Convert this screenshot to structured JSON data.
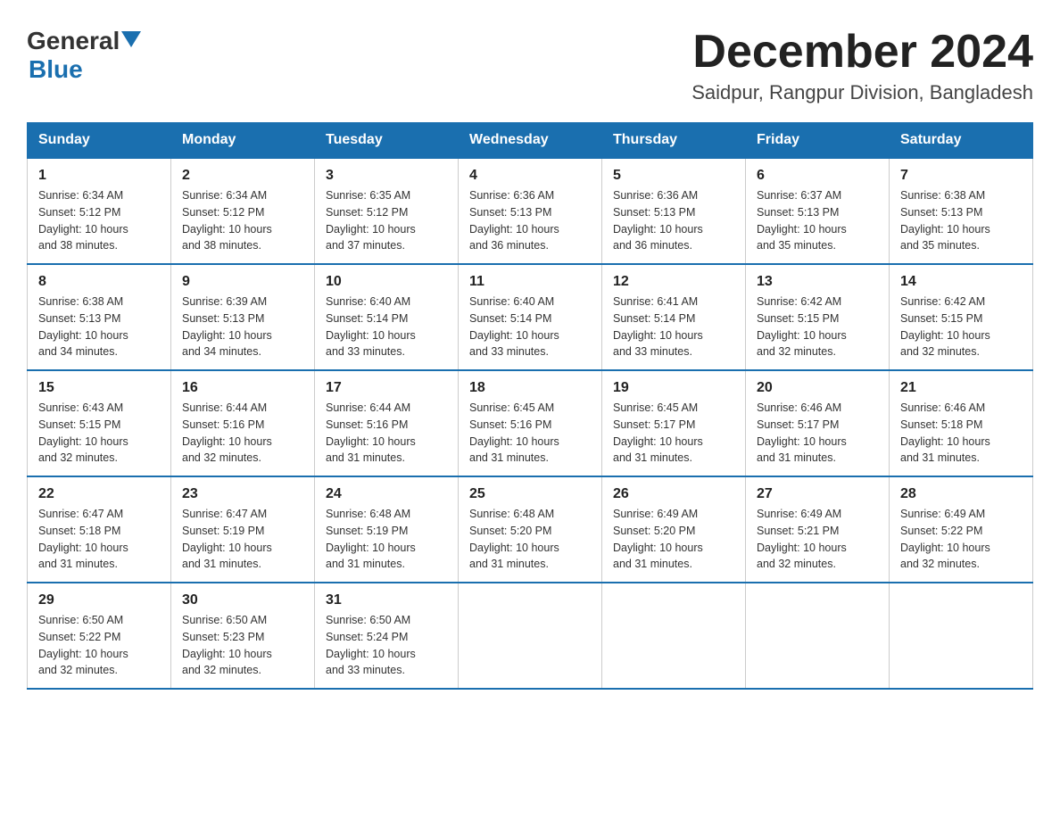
{
  "header": {
    "logo": {
      "general": "General",
      "blue": "Blue"
    },
    "title": "December 2024",
    "subtitle": "Saidpur, Rangpur Division, Bangladesh"
  },
  "calendar": {
    "days_of_week": [
      "Sunday",
      "Monday",
      "Tuesday",
      "Wednesday",
      "Thursday",
      "Friday",
      "Saturday"
    ],
    "weeks": [
      [
        {
          "day": "1",
          "sunrise": "6:34 AM",
          "sunset": "5:12 PM",
          "daylight": "10 hours and 38 minutes."
        },
        {
          "day": "2",
          "sunrise": "6:34 AM",
          "sunset": "5:12 PM",
          "daylight": "10 hours and 38 minutes."
        },
        {
          "day": "3",
          "sunrise": "6:35 AM",
          "sunset": "5:12 PM",
          "daylight": "10 hours and 37 minutes."
        },
        {
          "day": "4",
          "sunrise": "6:36 AM",
          "sunset": "5:13 PM",
          "daylight": "10 hours and 36 minutes."
        },
        {
          "day": "5",
          "sunrise": "6:36 AM",
          "sunset": "5:13 PM",
          "daylight": "10 hours and 36 minutes."
        },
        {
          "day": "6",
          "sunrise": "6:37 AM",
          "sunset": "5:13 PM",
          "daylight": "10 hours and 35 minutes."
        },
        {
          "day": "7",
          "sunrise": "6:38 AM",
          "sunset": "5:13 PM",
          "daylight": "10 hours and 35 minutes."
        }
      ],
      [
        {
          "day": "8",
          "sunrise": "6:38 AM",
          "sunset": "5:13 PM",
          "daylight": "10 hours and 34 minutes."
        },
        {
          "day": "9",
          "sunrise": "6:39 AM",
          "sunset": "5:13 PM",
          "daylight": "10 hours and 34 minutes."
        },
        {
          "day": "10",
          "sunrise": "6:40 AM",
          "sunset": "5:14 PM",
          "daylight": "10 hours and 33 minutes."
        },
        {
          "day": "11",
          "sunrise": "6:40 AM",
          "sunset": "5:14 PM",
          "daylight": "10 hours and 33 minutes."
        },
        {
          "day": "12",
          "sunrise": "6:41 AM",
          "sunset": "5:14 PM",
          "daylight": "10 hours and 33 minutes."
        },
        {
          "day": "13",
          "sunrise": "6:42 AM",
          "sunset": "5:15 PM",
          "daylight": "10 hours and 32 minutes."
        },
        {
          "day": "14",
          "sunrise": "6:42 AM",
          "sunset": "5:15 PM",
          "daylight": "10 hours and 32 minutes."
        }
      ],
      [
        {
          "day": "15",
          "sunrise": "6:43 AM",
          "sunset": "5:15 PM",
          "daylight": "10 hours and 32 minutes."
        },
        {
          "day": "16",
          "sunrise": "6:44 AM",
          "sunset": "5:16 PM",
          "daylight": "10 hours and 32 minutes."
        },
        {
          "day": "17",
          "sunrise": "6:44 AM",
          "sunset": "5:16 PM",
          "daylight": "10 hours and 31 minutes."
        },
        {
          "day": "18",
          "sunrise": "6:45 AM",
          "sunset": "5:16 PM",
          "daylight": "10 hours and 31 minutes."
        },
        {
          "day": "19",
          "sunrise": "6:45 AM",
          "sunset": "5:17 PM",
          "daylight": "10 hours and 31 minutes."
        },
        {
          "day": "20",
          "sunrise": "6:46 AM",
          "sunset": "5:17 PM",
          "daylight": "10 hours and 31 minutes."
        },
        {
          "day": "21",
          "sunrise": "6:46 AM",
          "sunset": "5:18 PM",
          "daylight": "10 hours and 31 minutes."
        }
      ],
      [
        {
          "day": "22",
          "sunrise": "6:47 AM",
          "sunset": "5:18 PM",
          "daylight": "10 hours and 31 minutes."
        },
        {
          "day": "23",
          "sunrise": "6:47 AM",
          "sunset": "5:19 PM",
          "daylight": "10 hours and 31 minutes."
        },
        {
          "day": "24",
          "sunrise": "6:48 AM",
          "sunset": "5:19 PM",
          "daylight": "10 hours and 31 minutes."
        },
        {
          "day": "25",
          "sunrise": "6:48 AM",
          "sunset": "5:20 PM",
          "daylight": "10 hours and 31 minutes."
        },
        {
          "day": "26",
          "sunrise": "6:49 AM",
          "sunset": "5:20 PM",
          "daylight": "10 hours and 31 minutes."
        },
        {
          "day": "27",
          "sunrise": "6:49 AM",
          "sunset": "5:21 PM",
          "daylight": "10 hours and 32 minutes."
        },
        {
          "day": "28",
          "sunrise": "6:49 AM",
          "sunset": "5:22 PM",
          "daylight": "10 hours and 32 minutes."
        }
      ],
      [
        {
          "day": "29",
          "sunrise": "6:50 AM",
          "sunset": "5:22 PM",
          "daylight": "10 hours and 32 minutes."
        },
        {
          "day": "30",
          "sunrise": "6:50 AM",
          "sunset": "5:23 PM",
          "daylight": "10 hours and 32 minutes."
        },
        {
          "day": "31",
          "sunrise": "6:50 AM",
          "sunset": "5:24 PM",
          "daylight": "10 hours and 33 minutes."
        },
        null,
        null,
        null,
        null
      ]
    ],
    "labels": {
      "sunrise": "Sunrise:",
      "sunset": "Sunset:",
      "daylight": "Daylight:"
    }
  }
}
